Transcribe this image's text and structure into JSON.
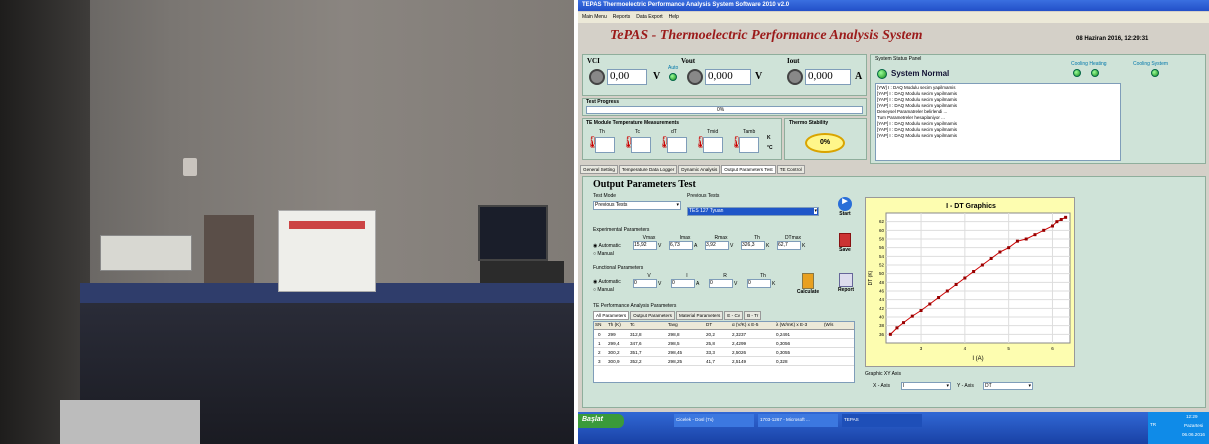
{
  "window": {
    "title": "TEPAS   Thermoelectric Performance Analysis System Software 2010  v2.0"
  },
  "menu": [
    "Main Menu",
    "Reports",
    "Data Export",
    "Help"
  ],
  "header": {
    "title": "TePAS - Thermoelectric Performance Analysis System",
    "datetime": "08 Haziran 2016, 12:29:31"
  },
  "vci": {
    "label": "VCI",
    "value": "0,00",
    "unit": "V",
    "auto": "Auto"
  },
  "vout": {
    "label": "Vout",
    "value": "0,000",
    "unit": "V"
  },
  "iout": {
    "label": "Iout",
    "value": "0,000",
    "unit": "A"
  },
  "status": {
    "title": "System Status Panel",
    "text": "System Normal",
    "cooling_heating": "Cooling Heating",
    "cooling_system": "Cooling System",
    "log": [
      "[YW] I : DAQ Modulu secim yapilmamis",
      "[YAP] I : DAQ Modulu secim yapilmamis",
      "[YAP] I : DAQ Modulu secim yapilmamis",
      "[YAP] I : DAQ Modulu secim yapilmamis",
      "Deneysel Paramatreler belirlendi ...",
      "Tum Parametreler hesaplaniyor ...",
      "[YAP] I : DAQ Modulu secim yapilmamis",
      "[YAP] I : DAQ Modulu secim yapilmamis",
      "[YAP] I : DAQ Modulu secim yapilmamis"
    ]
  },
  "progress": {
    "label": "Test Progress",
    "value": "0%",
    "fraction": 0
  },
  "temps": {
    "label": "TE Module Temperature Measurements",
    "fields": [
      "Th",
      "Tc",
      "dT",
      "Tmid",
      "Tamb"
    ],
    "unitK": "K",
    "unitC": "°C"
  },
  "thermo": {
    "label": "Thermo Stability",
    "value": "0%"
  },
  "tabs": [
    "General Setting",
    "Temperature Data Logger",
    "Dynamic Analysis",
    "Output Parameters Test",
    "TE Control"
  ],
  "opt": {
    "title": "Output Parameters Test",
    "test_mode_label": "Test Mode",
    "test_mode": "Previous Tests",
    "previous_label": "Previous Tests",
    "previous_value": "TES 127 Tyuan",
    "start": "Start",
    "save": "Save",
    "calculate": "Calculate",
    "report": "Report",
    "exp_label": "Experimental Parameters",
    "automatic": "Automatic",
    "manual": "Manual",
    "exp_cols": [
      "Vmax",
      "Imax",
      "Rmax",
      "Th",
      "DTmax"
    ],
    "exp_vals": [
      "15,92",
      "6,73",
      "3,92",
      "326,3",
      "62,7"
    ],
    "exp_units": [
      "V",
      "A",
      "K",
      "K"
    ],
    "func_label": "Functional Parameters",
    "func_cols": [
      "V",
      "I",
      "R",
      "Th"
    ],
    "func_vals": [
      "0",
      "0",
      "0",
      "0"
    ],
    "func_units": [
      "V",
      "A",
      "V",
      "K"
    ],
    "perf_label": "TE Performance Analysis Parameters",
    "perf_tabs": [
      "All Parameters",
      "Output Parameters",
      "Material Parameters",
      "E - Cv",
      "B - Tr"
    ],
    "table_headers": [
      "SN",
      "Th (K)",
      "Tc",
      "Tavg",
      "DT",
      "α (V/K) x E-5",
      "λ (W/mK) x E-3",
      "(W/s"
    ],
    "table_rows": [
      [
        "0",
        "299",
        "312,8",
        "298,8",
        "20,2",
        "2,3237",
        "0,2491"
      ],
      [
        "1",
        "299,4",
        "347,6",
        "298,5",
        "25,8",
        "2,4299",
        "0,3056"
      ],
      [
        "2",
        "300,2",
        "351,7",
        "298,45",
        "33,3",
        "2,5026",
        "0,3055"
      ],
      [
        "3",
        "300,9",
        "352,2",
        "298,25",
        "41,7",
        "2,5149",
        "0,328"
      ]
    ]
  },
  "graph": {
    "title": "I - DT Graphics",
    "xlabel": "I (A)",
    "ylabel": "DT (K)",
    "yticks": [
      "62",
      "60",
      "58",
      "56",
      "54",
      "52",
      "50",
      "48",
      "46",
      "44",
      "42",
      "40",
      "38",
      "36"
    ],
    "xticks": [
      "3",
      "4",
      "5",
      "6"
    ],
    "axis_label": "Graphic XY Axis",
    "x_axis_label": "X - Axis",
    "x_axis_value": "I",
    "y_axis_label": "Y - Axis",
    "y_axis_value": "DT"
  },
  "chart_data": {
    "type": "line",
    "title": "I - DT Graphics",
    "xlabel": "I (A)",
    "ylabel": "DT (K)",
    "xlim": [
      2.2,
      6.4
    ],
    "ylim": [
      34,
      64
    ],
    "x": [
      2.3,
      2.45,
      2.6,
      2.8,
      3.0,
      3.2,
      3.4,
      3.6,
      3.8,
      4.0,
      4.2,
      4.4,
      4.6,
      4.8,
      5.0,
      5.2,
      5.4,
      5.6,
      5.8,
      6.0,
      6.1,
      6.2,
      6.3
    ],
    "y": [
      36,
      37.5,
      38.7,
      40.2,
      41.5,
      43,
      44.5,
      46,
      47.5,
      49,
      50.5,
      52,
      53.5,
      55,
      56,
      57.5,
      58,
      59,
      60,
      61,
      62,
      62.5,
      63
    ]
  },
  "taskbar": {
    "start": "Başlat",
    "items": [
      "Cicelek - Dosl (7x)",
      "1703-1267 - Microsoft ...",
      "TEPAS"
    ],
    "lang": "TR",
    "time": "12:29",
    "day": "Pazartesi",
    "date": "06.06.2016"
  },
  "colors": {
    "accent": "#9b1a1a",
    "panel": "#cfe3d8",
    "graph_bg": "#fdfdb0",
    "line": "#cc0000"
  }
}
